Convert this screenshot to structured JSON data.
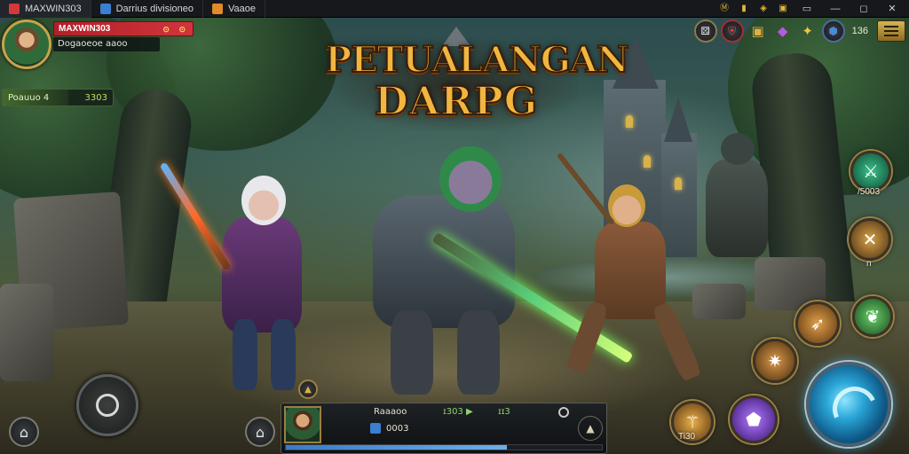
{
  "window": {
    "tabs": [
      {
        "label": "MAXWIN303",
        "icon_color": "#d23a3a"
      },
      {
        "label": "Darrius divisioneo",
        "icon_color": "#3a7fd0"
      },
      {
        "label": "Vaaoe",
        "icon_color": "#e08a2a"
      }
    ],
    "controls": [
      "▭",
      "—",
      "◻",
      "✕"
    ],
    "tray_icons": [
      "Ⓜ",
      "▮",
      "◈",
      "▣"
    ]
  },
  "player": {
    "name": "MAXWIN303",
    "subtitle": "Dogaoeoe aaoo",
    "name_icons": "⊙ ⊙",
    "quest_label": "Poauuo 4",
    "quest_value": "3303",
    "quest_progress": 0.6
  },
  "resources": {
    "items": [
      {
        "icon": "dice-icon",
        "glyph": "⚄",
        "color": "#e8e8e8"
      },
      {
        "icon": "shield-icon",
        "glyph": "⛨",
        "color": "#e04848"
      },
      {
        "icon": "chest-icon",
        "glyph": "▣",
        "color": "#e0b040"
      },
      {
        "icon": "gem-icon",
        "glyph": "◆",
        "color": "#b45adc"
      },
      {
        "icon": "star-icon",
        "glyph": "✦",
        "color": "#e8c848"
      },
      {
        "icon": "crystal-icon",
        "glyph": "⬢",
        "color": "#4a8ad8"
      }
    ],
    "count": "136"
  },
  "logo": {
    "line1": "PETUALANGAN",
    "line2": "DARPG"
  },
  "skills": [
    {
      "name": "skill-sword-slash",
      "glyph": "⚔",
      "label": "/5003",
      "color": "#2a9a6a"
    },
    {
      "name": "skill-crossed-blades",
      "glyph": "✕",
      "label": "n",
      "color": "#b07a2a"
    },
    {
      "name": "skill-arrow",
      "glyph": "➶",
      "label": "",
      "color": "#c08a30"
    },
    {
      "name": "skill-leaf-blade",
      "glyph": "❦",
      "label": "",
      "color": "#3aa048"
    },
    {
      "name": "skill-shuriken",
      "glyph": "✷",
      "label": "",
      "color": "#b0782a"
    },
    {
      "name": "skill-golden-sword",
      "glyph": "⚚",
      "label": "Ti30",
      "color": "#c88a2a"
    },
    {
      "name": "skill-purple-cube",
      "glyph": "⬟",
      "label": "",
      "color": "#7a3ad0"
    }
  ],
  "hero_bar": {
    "name": "Raaaoo",
    "stat1": "ɪ303 ▶",
    "stat2": "ɪɪ3",
    "level": "0003",
    "xp_progress": 0.7
  },
  "left_controls": {
    "home_glyph": "⌂",
    "house_glyph": "⌂"
  }
}
